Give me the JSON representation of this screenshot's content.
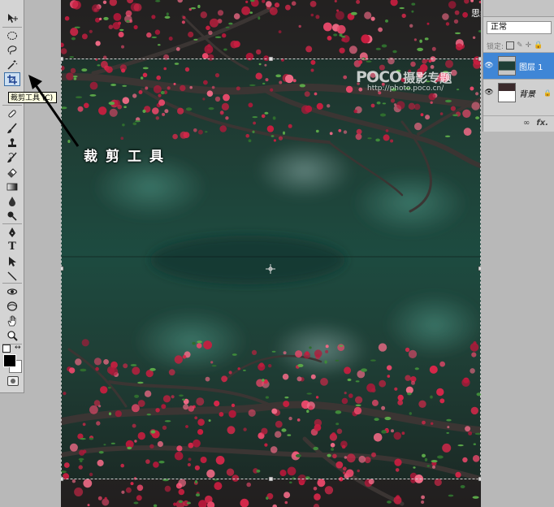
{
  "tools_panel": {
    "active_tool": "crop-tool",
    "tooltip": "裁剪工具 (C)",
    "tools": [
      {
        "name": "move-tool",
        "icon": "move-icon"
      },
      {
        "name": "marquee-tool",
        "icon": "ellipse-marquee-icon"
      },
      {
        "name": "lasso-tool",
        "icon": "lasso-icon"
      },
      {
        "name": "magic-wand-tool",
        "icon": "magic-wand-icon"
      },
      {
        "name": "crop-tool",
        "icon": "crop-icon"
      },
      {
        "name": "slice-tool",
        "icon": "slice-icon"
      },
      {
        "name": "healing-brush-tool",
        "icon": "bandage-icon"
      },
      {
        "name": "brush-tool",
        "icon": "brush-icon"
      },
      {
        "name": "clone-stamp-tool",
        "icon": "stamp-icon"
      },
      {
        "name": "history-brush-tool",
        "icon": "history-brush-icon"
      },
      {
        "name": "eraser-tool",
        "icon": "eraser-icon"
      },
      {
        "name": "gradient-tool",
        "icon": "gradient-icon"
      },
      {
        "name": "blur-tool",
        "icon": "drop-icon"
      },
      {
        "name": "dodge-tool",
        "icon": "dodge-icon"
      },
      {
        "name": "pen-tool",
        "icon": "pen-icon"
      },
      {
        "name": "type-tool",
        "icon": "type-icon"
      },
      {
        "name": "path-selection-tool",
        "icon": "arrow-pointer-icon"
      },
      {
        "name": "line-tool",
        "icon": "line-icon"
      },
      {
        "name": "3d-rotate-tool",
        "icon": "3d-rotate-icon"
      },
      {
        "name": "3d-orbit-tool",
        "icon": "3d-orbit-icon"
      },
      {
        "name": "hand-tool",
        "icon": "hand-icon"
      },
      {
        "name": "zoom-tool",
        "icon": "zoom-icon"
      }
    ],
    "type_glyph": "T",
    "foreground_color": "#000000",
    "background_color": "#ffffff"
  },
  "annotation": {
    "label": "裁剪工具"
  },
  "canvas": {
    "watermark": "思缘设计论坛 WWW.MISSYUAN.COM",
    "poco_logo": "POCO",
    "poco_cn": "摄影专题",
    "poco_url": "http://photo.poco.cn/"
  },
  "layers_panel": {
    "blend_mode": "正常",
    "lock_label": "锁定:",
    "layers": [
      {
        "name": "图层 1",
        "selected": true,
        "visible": true
      },
      {
        "name": "背景",
        "selected": false,
        "visible": true
      }
    ],
    "footer_icons": [
      "link-icon",
      "fx-icon"
    ],
    "fx_label": "fx."
  },
  "colors": {
    "selection": "#3f86d6",
    "tooltip_bg": "#ffffe1",
    "blossom": "#d8274a",
    "foliage": "#1f4a3c"
  }
}
